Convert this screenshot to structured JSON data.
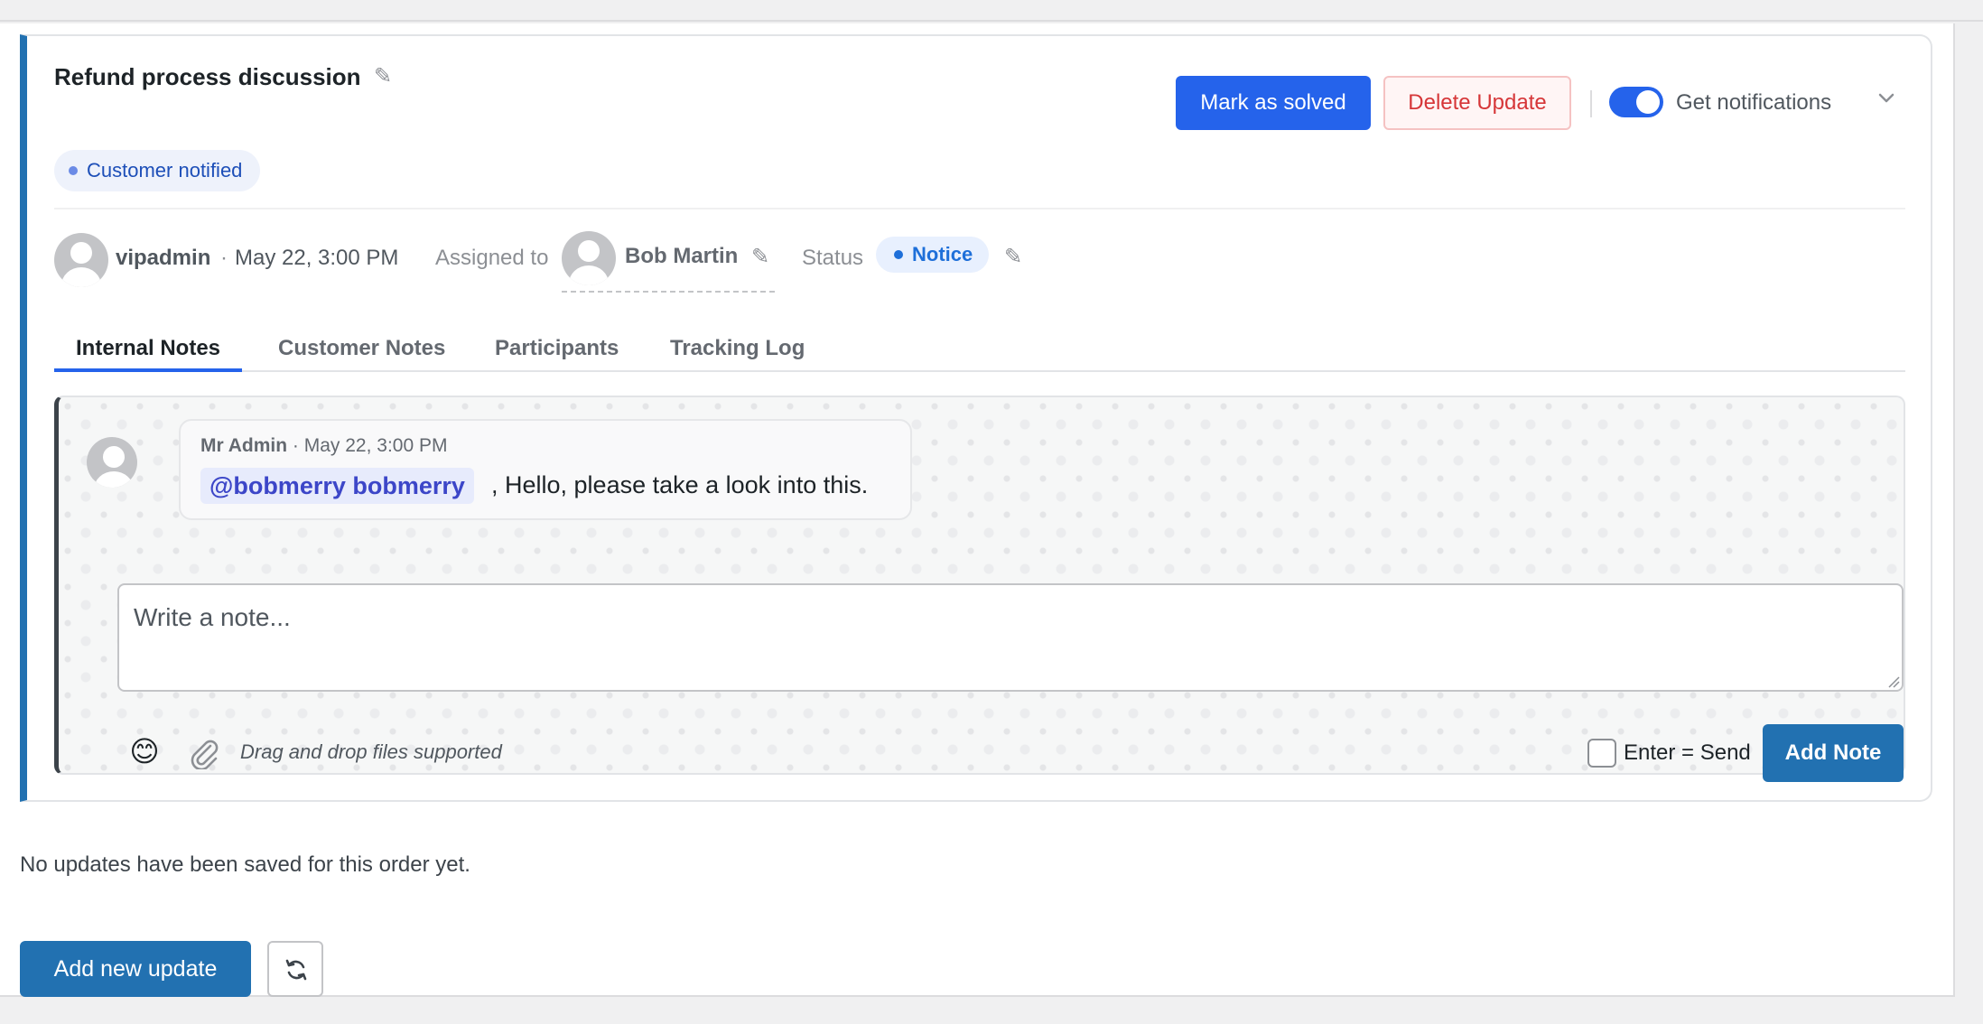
{
  "update": {
    "title": "Refund process discussion",
    "mark_solved_label": "Mark as solved",
    "delete_label": "Delete Update",
    "notifications_label": "Get notifications",
    "notifications_on": true,
    "customer_badge": "Customer notified",
    "author": "vipadmin",
    "separator": "·",
    "date": "May 22, 3:00 PM",
    "assigned_label": "Assigned to",
    "assignee": "Bob Martin",
    "status_label": "Status",
    "status_value": "Notice"
  },
  "tabs": [
    {
      "label": "Internal Notes",
      "active": true
    },
    {
      "label": "Customer Notes",
      "active": false
    },
    {
      "label": "Participants",
      "active": false
    },
    {
      "label": "Tracking Log",
      "active": false
    }
  ],
  "note": {
    "author": "Mr Admin",
    "meta_rest": " · May 22, 3:00 PM",
    "mention": "@bobmerry bobmerry",
    "text": ", Hello, please take a look into this."
  },
  "composer": {
    "placeholder": "Write a note...",
    "emoji": "😊",
    "drag_hint": "Drag and drop files supported",
    "enter_send_label": "Enter = Send",
    "add_note_label": "Add Note"
  },
  "footer": {
    "no_updates_text": "No updates have been saved for this order yet.",
    "add_new_update_label": "Add new update"
  },
  "colors": {
    "primary": "#2563eb",
    "wp_blue": "#2271b1",
    "danger": "#d63638"
  }
}
